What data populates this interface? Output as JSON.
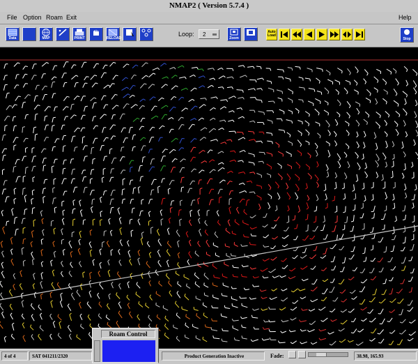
{
  "window": {
    "title": "NMAP2 ( Version 5.7.4 )"
  },
  "menu": {
    "items": [
      "File",
      "Option",
      "Roam",
      "Exit"
    ],
    "help": "Help"
  },
  "toolbar": {
    "buttons": [
      {
        "caption": "Data",
        "icon": "data-icon"
      },
      {
        "caption": "",
        "icon": "blank-icon"
      },
      {
        "caption": "MAP",
        "icon": "globe-icon"
      },
      {
        "caption": "",
        "icon": "pencil-icon"
      },
      {
        "caption": "PRINT",
        "icon": "printer-icon"
      },
      {
        "caption": "",
        "icon": "hand-icon"
      },
      {
        "caption": "RELOAD",
        "icon": "reload-icon"
      },
      {
        "caption": "",
        "icon": "cursor-icon"
      },
      {
        "caption": "",
        "icon": "multi-icon"
      },
      {
        "caption": "Zoom",
        "icon": "zoom-icon"
      },
      {
        "caption": "",
        "icon": "unzoom-icon"
      }
    ],
    "loop_label": "Loop:",
    "loop_value": "2",
    "frame_buttons": [
      {
        "caption": "Auto Load",
        "icon": "auto-load-icon"
      },
      {
        "caption": "",
        "icon": "first-frame-icon"
      },
      {
        "caption": "",
        "icon": "rewind-icon"
      },
      {
        "caption": "",
        "icon": "step-back-icon"
      },
      {
        "caption": "",
        "icon": "step-forward-icon"
      },
      {
        "caption": "",
        "icon": "fast-forward-icon"
      },
      {
        "caption": "",
        "icon": "rock-icon"
      },
      {
        "caption": "",
        "icon": "last-frame-icon"
      }
    ],
    "stop_label": "Stop"
  },
  "status": {
    "frame": "4 of 4",
    "timestamp": "SAT 041211/2320",
    "product": "Product Generation Inactive",
    "fade_label": "Fade:",
    "fade_level": 0.25,
    "coords": "38.98, 165.93"
  },
  "roam_control": {
    "title": "Roam Control"
  },
  "colors": {
    "accent_blue": "#1f3fc8",
    "frame_yellow": "#f2e21a",
    "map_background": "#000000",
    "overlay_line": "#c8c8c8",
    "top_line": "#b03030"
  },
  "map": {
    "description_icon": "wind-barbs"
  }
}
